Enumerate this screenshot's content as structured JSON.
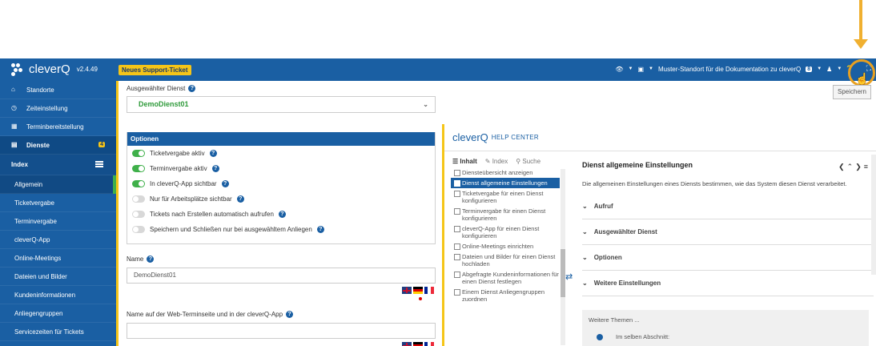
{
  "app": {
    "name": "cleverQ",
    "version": "v2.4.49",
    "support_label": "Neues Support-Ticket"
  },
  "header": {
    "location": "Muster-Standort für die Dokumentation zu cleverQ",
    "location_badge": "8",
    "help_label": "?"
  },
  "sidebar": {
    "items": [
      {
        "label": "Standorte"
      },
      {
        "label": "Zeiteinstellung"
      },
      {
        "label": "Terminbereitstellung"
      },
      {
        "label": "Dienste",
        "count": "4"
      }
    ],
    "index_label": "Index",
    "sub_items": [
      {
        "label": "Allgemein"
      },
      {
        "label": "Ticketvergabe"
      },
      {
        "label": "Terminvergabe"
      },
      {
        "label": "cleverQ-App"
      },
      {
        "label": "Online-Meetings"
      },
      {
        "label": "Dateien und Bilder"
      },
      {
        "label": "Kundeninformationen"
      },
      {
        "label": "Anliegengruppen"
      },
      {
        "label": "Servicezeiten für Tickets"
      }
    ]
  },
  "form": {
    "service_label": "Ausgewählter Dienst",
    "service_value": "DemoDienst01",
    "save_label": "Speichern",
    "options_title": "Optionen",
    "options": [
      {
        "label": "Ticketvergabe aktiv",
        "on": true
      },
      {
        "label": "Terminvergabe aktiv",
        "on": true
      },
      {
        "label": "In cleverQ-App sichtbar",
        "on": true
      },
      {
        "label": "Nur für Arbeitsplätze sichtbar",
        "on": false
      },
      {
        "label": "Tickets nach Erstellen automatisch aufrufen",
        "on": false
      },
      {
        "label": "Speichern und Schließen nur bei ausgewähltem Anliegen",
        "on": false
      }
    ],
    "name_label": "Name",
    "name_value": "DemoDienst01",
    "web_label": "Name auf der Web-Terminseite und in der cleverQ-App"
  },
  "help": {
    "brand": "cleverQ",
    "title": "HELP CENTER",
    "tabs": {
      "contents": "Inhalt",
      "index": "Index",
      "search": "Suche"
    },
    "toc": [
      "Diensteübersicht anzeigen",
      "Dienst allgemeine Einstellungen",
      "Ticketvergabe für einen Dienst konfigurieren",
      "Terminvergabe für einen Dienst konfigurieren",
      "cleverQ-App für einen Dienst konfigurieren",
      "Online-Meetings einrichten",
      "Dateien und Bilder für einen Dienst hochladen",
      "Abgefragte Kundeninformationen für einen Dienst festlegen",
      "Einem Dienst Anliegengruppen zuordnen"
    ],
    "topic_title": "Dienst allgemeine Einstellungen",
    "topic_text": "Die allgemeinen Einstellungen eines Diensts bestimmen, wie das System diesen Dienst verarbeitet.",
    "sections": [
      "Aufruf",
      "Ausgewählter Dienst",
      "Optionen",
      "Weitere Einstellungen"
    ],
    "further_title": "Weitere Themen ...",
    "further_item": "Im selben Abschnitt:"
  }
}
